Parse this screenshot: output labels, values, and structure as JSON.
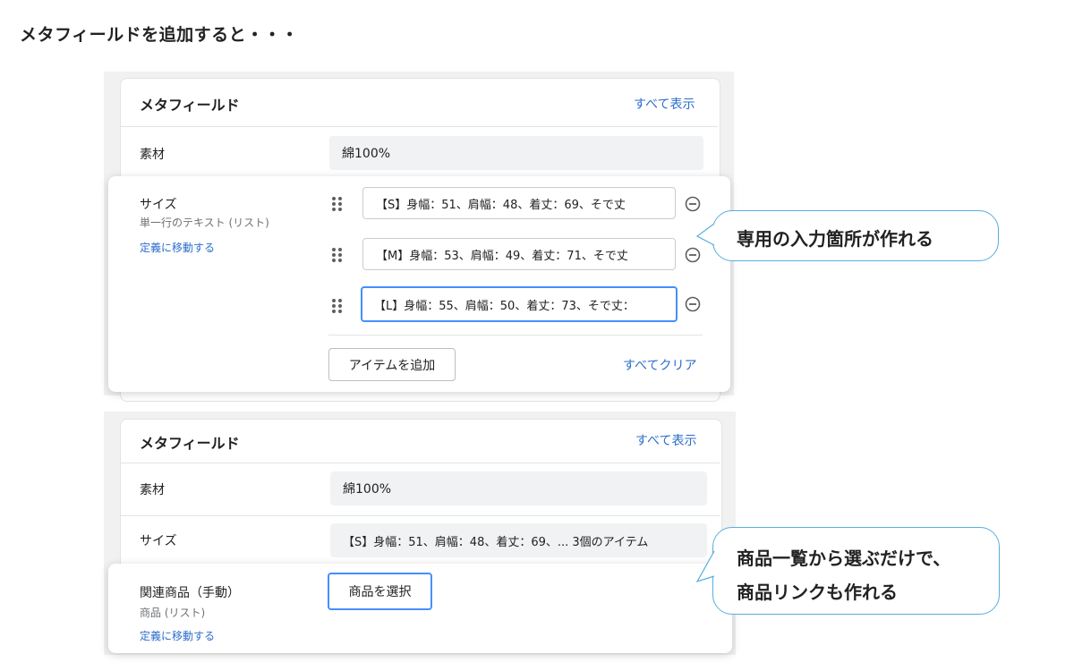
{
  "heading": "メタフィールドを追加すると・・・",
  "panel1": {
    "title": "メタフィールド",
    "show_all": "すべて表示",
    "material": {
      "label": "素材",
      "value": "綿100%"
    },
    "size": {
      "label": "サイズ",
      "type": "単一行のテキスト (リスト)",
      "define_link": "定義に移動する",
      "items": [
        "【S】身幅：51、肩幅：48、着丈：69、そで丈",
        "【M】身幅：53、肩幅：49、着丈：71、そで丈",
        "【L】身幅：55、肩幅：50、着丈：73、そで丈："
      ],
      "add_button": "アイテムを追加",
      "clear_all": "すべてクリア"
    },
    "callout": "専用の入力箇所が作れる"
  },
  "panel2": {
    "title": "メタフィールド",
    "show_all": "すべて表示",
    "material": {
      "label": "素材",
      "value": "綿100%"
    },
    "size": {
      "label": "サイズ",
      "value": "【S】身幅：51、肩幅：48、着丈：69、...  3個のアイテム"
    },
    "related": {
      "label": "関連商品（手動）",
      "type": "商品 (リスト)",
      "define_link": "定義に移動する",
      "select_button": "商品を選択"
    },
    "callout_line1": "商品一覧から選ぶだけで、",
    "callout_line2": "商品リンクも作れる"
  },
  "colors": {
    "link": "#2c6ecb",
    "focus": "#458fff",
    "bubble_border": "#57aede"
  }
}
